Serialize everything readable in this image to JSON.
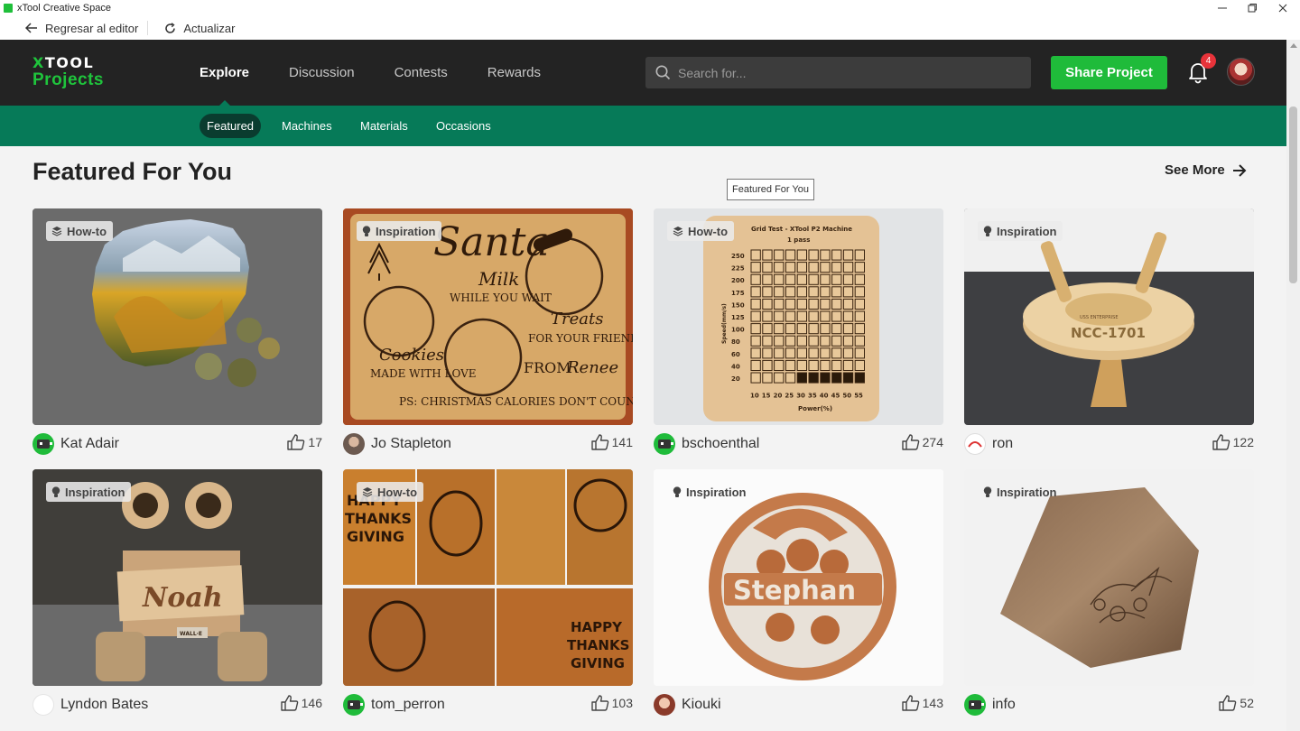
{
  "window": {
    "title": "xTool Creative Space"
  },
  "toolbar": {
    "back_label": "Regresar al editor",
    "refresh_label": "Actualizar"
  },
  "logo": {
    "line1": "XTOOL",
    "line2": "Projects"
  },
  "nav": [
    {
      "label": "Explore",
      "active": true
    },
    {
      "label": "Discussion"
    },
    {
      "label": "Contests"
    },
    {
      "label": "Rewards"
    }
  ],
  "search": {
    "placeholder": "Search for..."
  },
  "share_button": "Share Project",
  "notifications": {
    "count": "4"
  },
  "subnav": [
    {
      "label": "Featured",
      "active": true
    },
    {
      "label": "Machines"
    },
    {
      "label": "Materials"
    },
    {
      "label": "Occasions"
    }
  ],
  "section": {
    "title": "Featured For You",
    "see_more": "See More",
    "tooltip": "Featured For You"
  },
  "cards": [
    {
      "tag": "How-to",
      "tag_icon": "layers-icon",
      "author": "Kat Adair",
      "likes": "17"
    },
    {
      "tag": "Inspiration",
      "tag_icon": "lightbulb-icon",
      "author": "Jo Stapleton",
      "likes": "141"
    },
    {
      "tag": "How-to",
      "tag_icon": "layers-icon",
      "author": "bschoenthal",
      "likes": "274"
    },
    {
      "tag": "Inspiration",
      "tag_icon": "lightbulb-icon",
      "author": "ron",
      "likes": "122"
    },
    {
      "tag": "Inspiration",
      "tag_icon": "lightbulb-icon",
      "author": "Lyndon Bates",
      "likes": "146"
    },
    {
      "tag": "How-to",
      "tag_icon": "layers-icon",
      "author": "tom_perron",
      "likes": "103"
    },
    {
      "tag": "Inspiration",
      "tag_icon": "lightbulb-icon",
      "author": "Kiouki",
      "likes": "143"
    },
    {
      "tag": "Inspiration",
      "tag_icon": "lightbulb-icon",
      "author": "info",
      "likes": "52"
    }
  ],
  "card_images": {
    "santa_board": [
      "Santa",
      "Milk",
      "WHILE YOU WAIT",
      "Treats",
      "FOR YOUR FRIENDS",
      "Cookies",
      "MADE WITH LOVE",
      "FROM",
      "Renee",
      "PS: CHRISTMAS CALORIES DON'T COUNT"
    ],
    "grid_test": {
      "title": "Grid Test - XTool P2 Machine",
      "subtitle": "1 pass",
      "y_label": "Speed(mm/s)",
      "x_label": "Power(%)",
      "speeds": [
        "250",
        "225",
        "200",
        "175",
        "150",
        "125",
        "100",
        "80",
        "60",
        "40",
        "20"
      ],
      "powers": [
        "10",
        "15",
        "20",
        "25",
        "30",
        "35",
        "40",
        "45",
        "50",
        "55"
      ]
    },
    "starship": {
      "registry": "NCC-1701",
      "name": "USS ENTERPRISE"
    },
    "robot_sign": "Noah",
    "robot_plate": "WALL·E",
    "ornament_name": "Stephan",
    "thanksgiving": [
      "HAPPY",
      "THANKS",
      "GIVING"
    ]
  },
  "colors": {
    "header_bg": "#232323",
    "brand_green": "#1fbb3a",
    "subnav_green": "#067a58",
    "badge_red": "#e8333a"
  }
}
